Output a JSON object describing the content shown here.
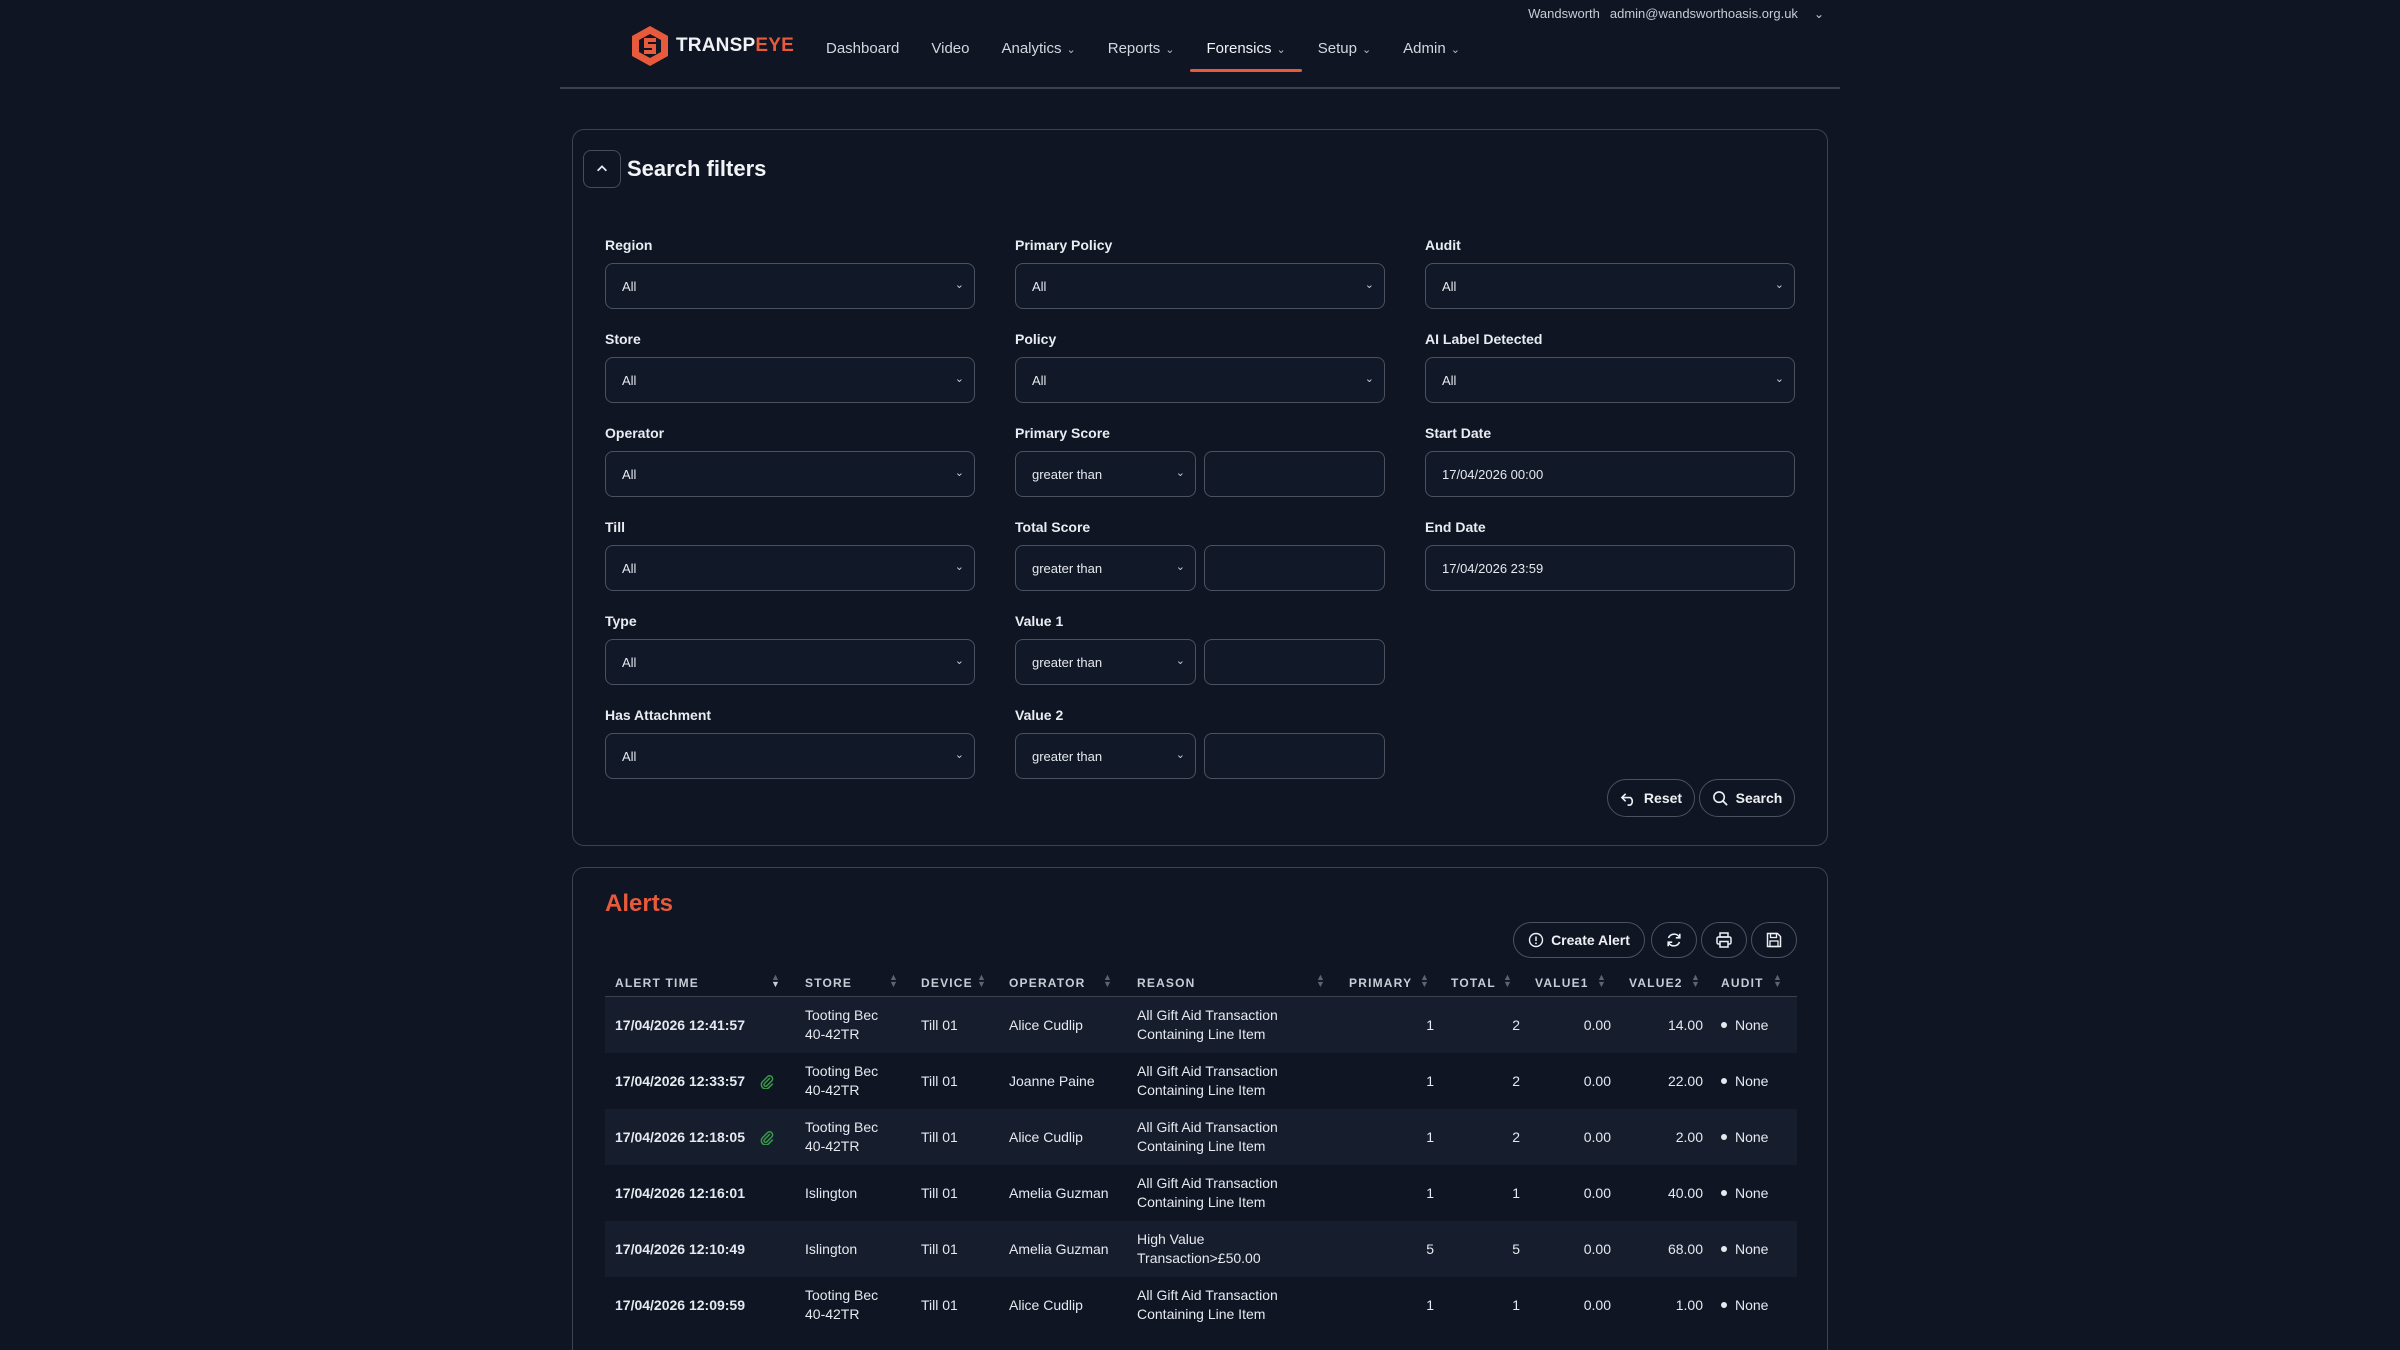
{
  "header": {
    "location": "Wandsworth",
    "email": "admin@wandsworthoasis.org.uk",
    "logo_main": "TRANSP",
    "logo_accent": "EYE",
    "nav": [
      {
        "label": "Dashboard",
        "dropdown": false,
        "active": false
      },
      {
        "label": "Video",
        "dropdown": false,
        "active": false
      },
      {
        "label": "Analytics",
        "dropdown": true,
        "active": false
      },
      {
        "label": "Reports",
        "dropdown": true,
        "active": false
      },
      {
        "label": "Forensics",
        "dropdown": true,
        "active": true
      },
      {
        "label": "Setup",
        "dropdown": true,
        "active": false
      },
      {
        "label": "Admin",
        "dropdown": true,
        "active": false
      }
    ]
  },
  "filters": {
    "title": "Search filters",
    "region": {
      "label": "Region",
      "value": "All"
    },
    "store": {
      "label": "Store",
      "value": "All"
    },
    "operator": {
      "label": "Operator",
      "value": "All"
    },
    "till": {
      "label": "Till",
      "value": "All"
    },
    "type": {
      "label": "Type",
      "value": "All"
    },
    "has_attachment": {
      "label": "Has Attachment",
      "value": "All"
    },
    "primary_policy": {
      "label": "Primary Policy",
      "value": "All"
    },
    "policy": {
      "label": "Policy",
      "value": "All"
    },
    "primary_score": {
      "label": "Primary Score",
      "op": "greater than",
      "value": ""
    },
    "total_score": {
      "label": "Total Score",
      "op": "greater than",
      "value": ""
    },
    "value1": {
      "label": "Value 1",
      "op": "greater than",
      "value": ""
    },
    "value2": {
      "label": "Value 2",
      "op": "greater than",
      "value": ""
    },
    "audit": {
      "label": "Audit",
      "value": "All"
    },
    "ai_label": {
      "label": "AI Label Detected",
      "value": "All"
    },
    "start_date": {
      "label": "Start Date",
      "value": "17/04/2026 00:00"
    },
    "end_date": {
      "label": "End Date",
      "value": "17/04/2026 23:59"
    },
    "reset_label": "Reset",
    "search_label": "Search"
  },
  "alerts": {
    "title": "Alerts",
    "create_label": "Create Alert",
    "columns": [
      "ALERT TIME",
      "STORE",
      "DEVICE",
      "OPERATOR",
      "REASON",
      "PRIMARY",
      "TOTAL",
      "VALUE1",
      "VALUE2",
      "AUDIT"
    ],
    "rows": [
      {
        "time": "17/04/2026 12:41:57",
        "attachment": false,
        "store1": "Tooting Bec",
        "store2": "40-42TR",
        "device": "Till 01",
        "operator": "Alice Cudlip",
        "reason1": "All Gift Aid Transaction",
        "reason2": "Containing Line Item",
        "primary": "1",
        "total": "2",
        "value1": "0.00",
        "value2": "14.00",
        "audit": "None"
      },
      {
        "time": "17/04/2026 12:33:57",
        "attachment": true,
        "store1": "Tooting Bec",
        "store2": "40-42TR",
        "device": "Till 01",
        "operator": "Joanne Paine",
        "reason1": "All Gift Aid Transaction",
        "reason2": "Containing Line Item",
        "primary": "1",
        "total": "2",
        "value1": "0.00",
        "value2": "22.00",
        "audit": "None"
      },
      {
        "time": "17/04/2026 12:18:05",
        "attachment": true,
        "store1": "Tooting Bec",
        "store2": "40-42TR",
        "device": "Till 01",
        "operator": "Alice Cudlip",
        "reason1": "All Gift Aid Transaction",
        "reason2": "Containing Line Item",
        "primary": "1",
        "total": "2",
        "value1": "0.00",
        "value2": "2.00",
        "audit": "None"
      },
      {
        "time": "17/04/2026 12:16:01",
        "attachment": false,
        "store1": "Islington",
        "store2": "",
        "device": "Till 01",
        "operator": "Amelia Guzman",
        "reason1": "All Gift Aid Transaction",
        "reason2": "Containing Line Item",
        "primary": "1",
        "total": "1",
        "value1": "0.00",
        "value2": "40.00",
        "audit": "None"
      },
      {
        "time": "17/04/2026 12:10:49",
        "attachment": false,
        "store1": "Islington",
        "store2": "",
        "device": "Till 01",
        "operator": "Amelia Guzman",
        "reason1": "High Value",
        "reason2": "Transaction>£50.00",
        "primary": "5",
        "total": "5",
        "value1": "0.00",
        "value2": "68.00",
        "audit": "None"
      },
      {
        "time": "17/04/2026 12:09:59",
        "attachment": false,
        "store1": "Tooting Bec",
        "store2": "40-42TR",
        "device": "Till 01",
        "operator": "Alice Cudlip",
        "reason1": "All Gift Aid Transaction",
        "reason2": "Containing Line Item",
        "primary": "1",
        "total": "1",
        "value1": "0.00",
        "value2": "1.00",
        "audit": "None"
      }
    ]
  },
  "colors": {
    "accent": "#e85a3c",
    "background": "#0f1523",
    "attachment": "#3c9a4a"
  }
}
